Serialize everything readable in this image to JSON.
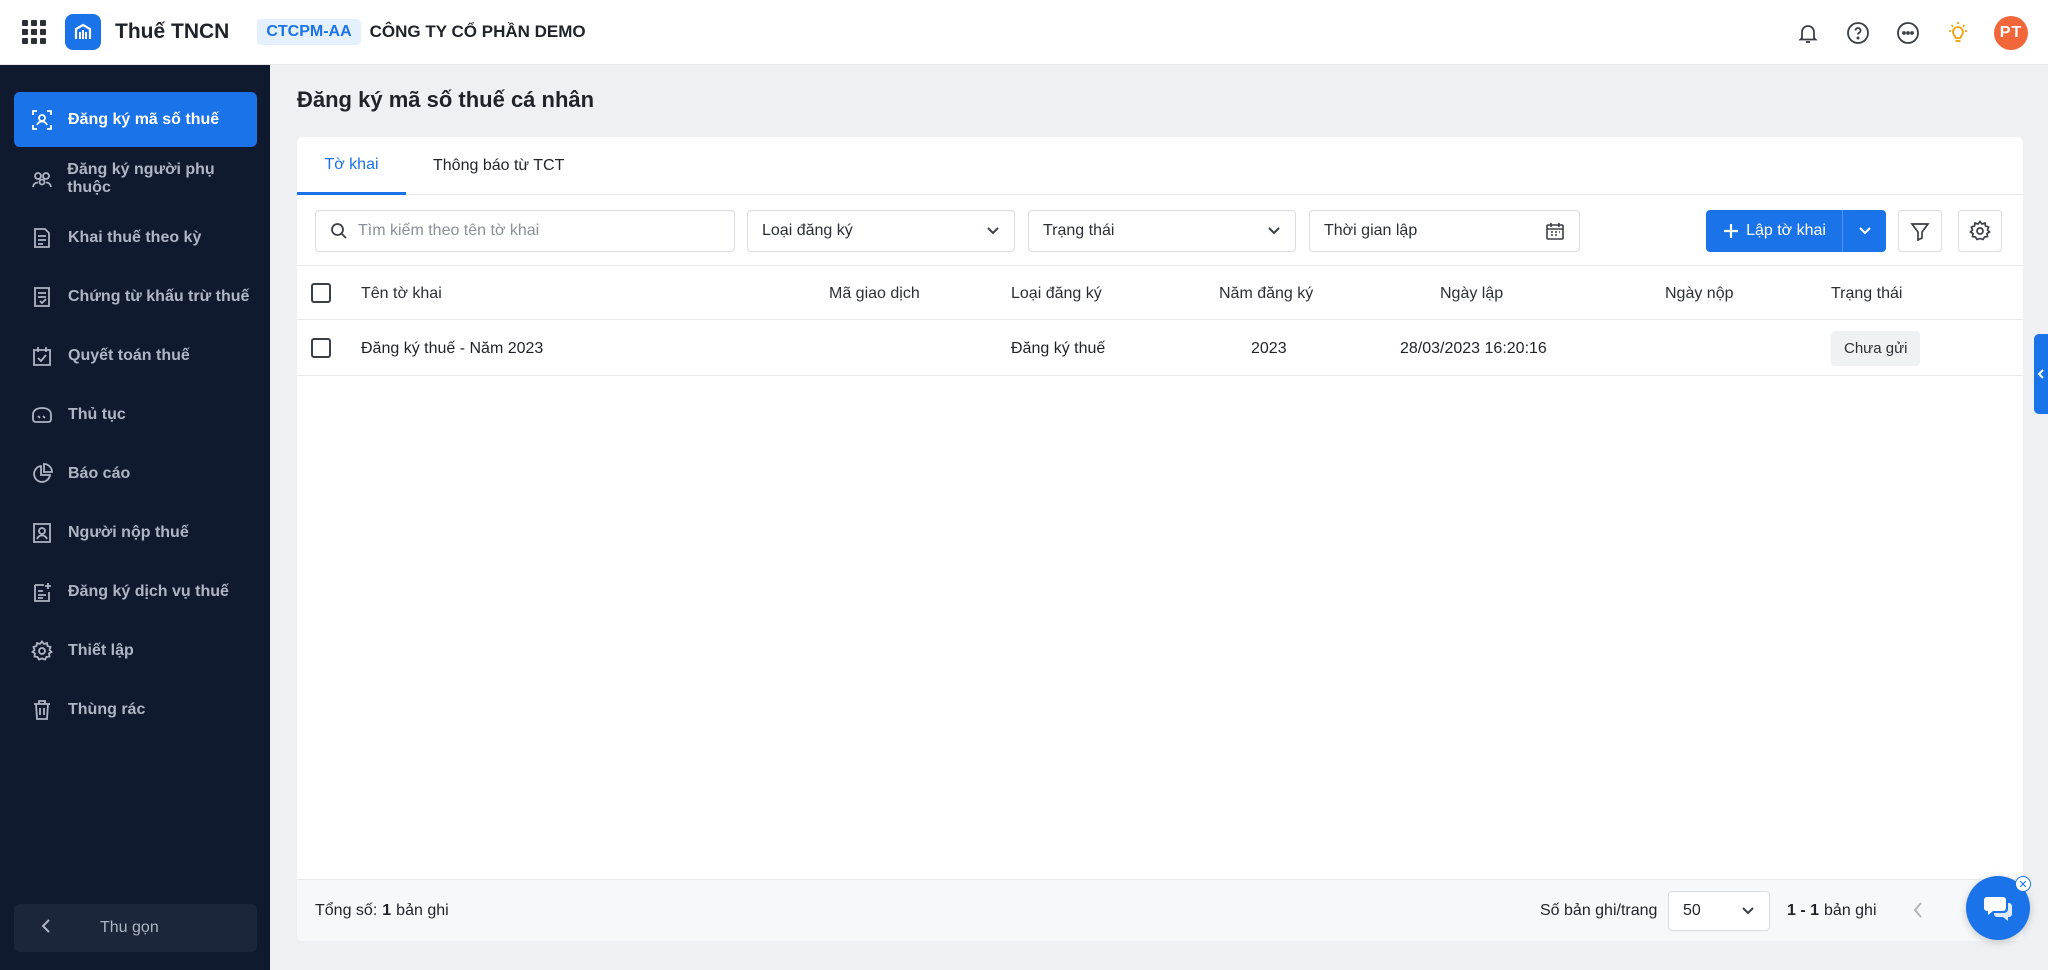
{
  "header": {
    "app_title": "Thuế TNCN",
    "company_code": "CTCPM-AA",
    "company_name": "CÔNG TY CỔ PHẦN DEMO",
    "avatar_initials": "PT",
    "icons": [
      "apps-grid-icon",
      "bell-icon",
      "help-icon",
      "more-icon",
      "lightbulb-icon"
    ]
  },
  "sidebar": {
    "items": [
      {
        "label": "Đăng ký mã số thuế",
        "icon": "user-scan-icon",
        "active": true
      },
      {
        "label": "Đăng ký người phụ thuộc",
        "icon": "group-icon"
      },
      {
        "label": "Khai thuế theo kỳ",
        "icon": "document-icon"
      },
      {
        "label": "Chứng từ khấu trừ thuế",
        "icon": "receipt-icon"
      },
      {
        "label": "Quyết toán thuế",
        "icon": "settlement-icon"
      },
      {
        "label": "Thủ tục",
        "icon": "procedure-icon"
      },
      {
        "label": "Báo cáo",
        "icon": "pie-chart-icon"
      },
      {
        "label": "Người nộp thuế",
        "icon": "taxpayer-icon"
      },
      {
        "label": "Đăng ký dịch vụ thuế",
        "icon": "service-register-icon"
      },
      {
        "label": "Thiết lập",
        "icon": "gear-icon"
      },
      {
        "label": "Thùng rác",
        "icon": "trash-icon"
      }
    ],
    "collapse_label": "Thu gọn"
  },
  "main": {
    "page_title": "Đăng ký mã số thuế cá nhân",
    "tabs": [
      {
        "label": "Tờ khai",
        "active": true
      },
      {
        "label": "Thông báo từ TCT"
      }
    ],
    "toolbar": {
      "search_placeholder": "Tìm kiếm theo tên tờ khai",
      "type_select": "Loại đăng ký",
      "status_select": "Trạng thái",
      "date_field": "Thời gian lập",
      "create_button": "Lập tờ khai"
    },
    "table": {
      "columns": [
        "Tên tờ khai",
        "Mã giao dịch",
        "Loại đăng ký",
        "Năm đăng ký",
        "Ngày lập",
        "Ngày nộp",
        "Trạng thái"
      ],
      "rows": [
        {
          "name": "Đăng ký thuế - Năm 2023",
          "transaction_code": "",
          "type": "Đăng ký thuế",
          "year": "2023",
          "created": "28/03/2023 16:20:16",
          "submitted": "",
          "status": "Chưa gửi"
        }
      ]
    },
    "footer": {
      "total_label": "Tổng số:",
      "total_count": "1",
      "total_unit": "bản ghi",
      "page_size_label": "Số bản ghi/trang",
      "page_size": "50",
      "range": "1 - 1",
      "range_unit": "bản ghi"
    }
  },
  "colors": {
    "accent": "#1a73e8",
    "sidebar_bg": "#0f1a2e",
    "avatar": "#f1673a",
    "bulb": "#f59e0b"
  }
}
